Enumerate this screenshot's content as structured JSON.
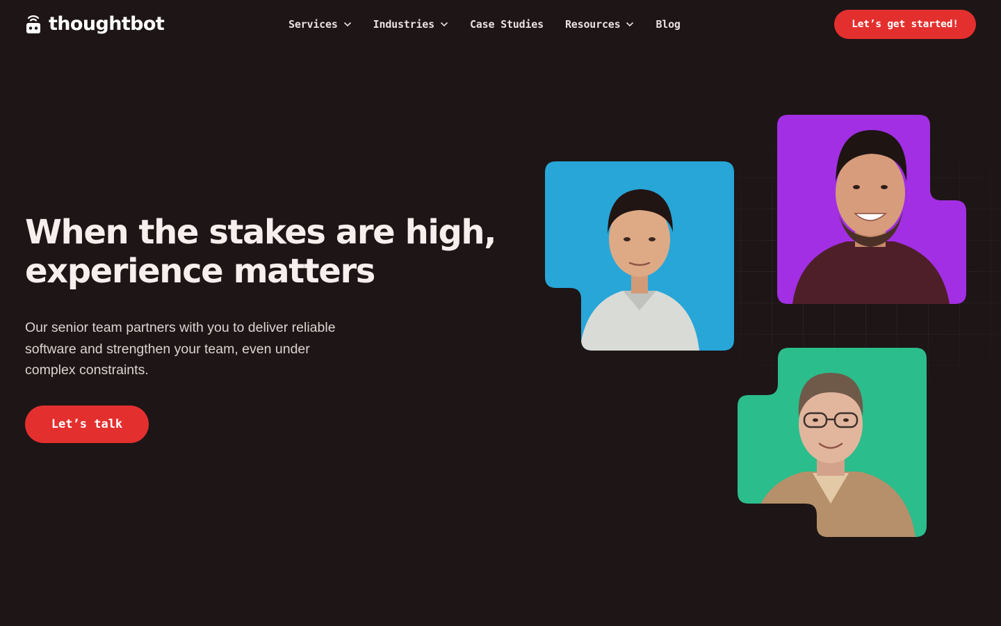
{
  "brand": {
    "name": "thoughtbot",
    "accent_color": "#e3302f",
    "background_color": "#1e1516"
  },
  "nav": {
    "items": [
      {
        "label": "Services",
        "has_dropdown": true
      },
      {
        "label": "Industries",
        "has_dropdown": true
      },
      {
        "label": "Case Studies",
        "has_dropdown": false
      },
      {
        "label": "Resources",
        "has_dropdown": true
      },
      {
        "label": "Blog",
        "has_dropdown": false
      }
    ],
    "cta_label": "Let’s get started!"
  },
  "hero": {
    "title_lines": [
      "When the stakes are high,",
      "experience matters"
    ],
    "subtitle_lines": [
      "Our senior team partners with you to deliver reliable",
      "software and strengthen your team, even under",
      "complex constraints."
    ],
    "cta_label": "Let’s talk"
  },
  "portraits": [
    {
      "icon": "person-portrait",
      "background_color": "#28a6d8",
      "shirt_color": "#d9dbd6"
    },
    {
      "icon": "person-portrait",
      "background_color": "#a22fe3",
      "shirt_color": "#4e1f28"
    },
    {
      "icon": "person-portrait",
      "background_color": "#2bbd8c",
      "shirt_color": "#b6906a"
    }
  ]
}
